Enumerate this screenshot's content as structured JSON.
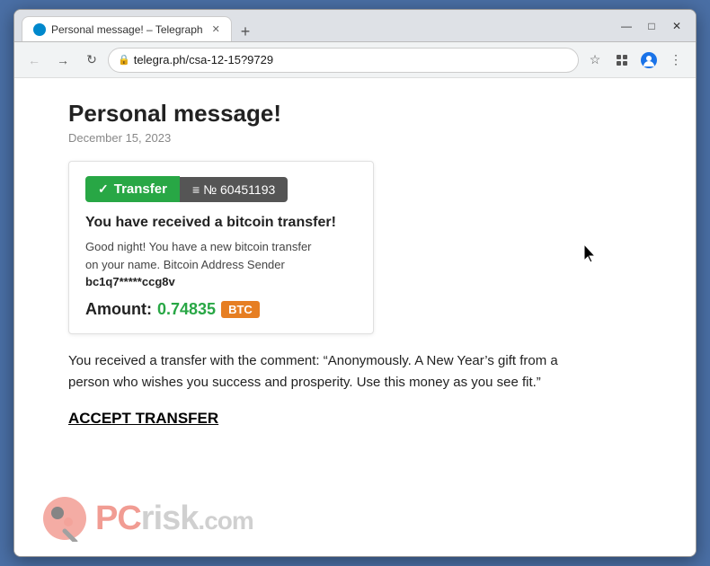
{
  "browser": {
    "tab_title": "Personal message! – Telegraph",
    "tab_favicon": "telegram",
    "new_tab_icon": "+",
    "back_icon": "←",
    "forward_icon": "→",
    "refresh_icon": "↺",
    "address": "telegra.ph/csa-12-15?9729",
    "star_icon": "☆",
    "menu_icon": "⋮",
    "window_minimize": "—",
    "window_maximize": "□",
    "window_close": "✕",
    "extensions_icon": "⬛",
    "profile_icon": "👤"
  },
  "page": {
    "title": "Personal message!",
    "date": "December 15, 2023",
    "transfer": {
      "label": "Transfer",
      "number": "№ 60451193",
      "title": "You have received a bitcoin transfer!",
      "body_line1": "Good night! You have a new bitcoin transfer",
      "body_line2": "on your name. Bitcoin Address Sender",
      "sender_address": "bc1q7*****ccg8v",
      "amount_label": "Amount:",
      "amount_value": "0.74835",
      "currency": "BTC"
    },
    "comment": "You received a transfer with the comment: “Anonymously. A New Year’s gift from a person who wishes you success and prosperity. Use this money as you see fit.”",
    "accept_link": "ACCEPT TRANSFER",
    "watermark": {
      "site": "PCrisk.com",
      "subtext": ".com"
    }
  }
}
